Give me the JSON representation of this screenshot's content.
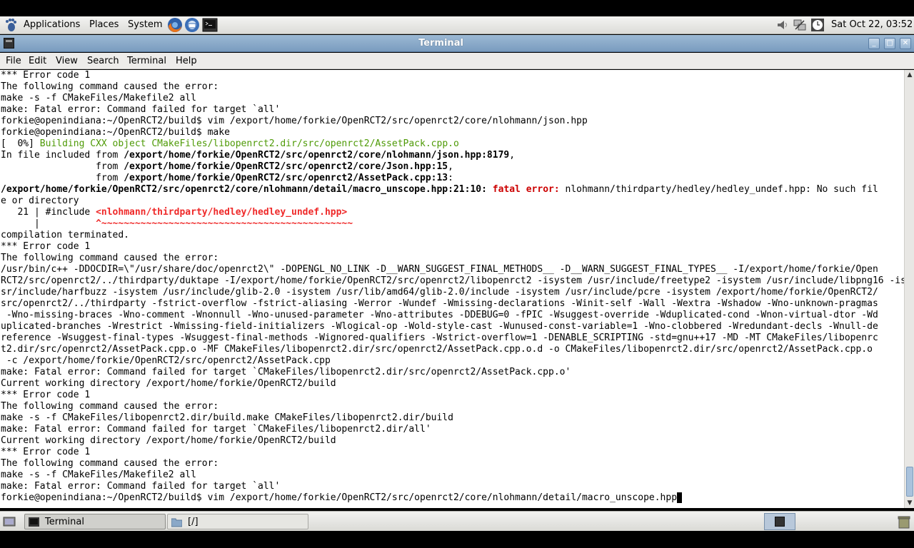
{
  "top_panel": {
    "menus": [
      "Applications",
      "Places",
      "System"
    ],
    "clock": "Sat Oct 22, 03:52"
  },
  "window": {
    "title": "Terminal",
    "buttons": [
      "minimize",
      "maximize",
      "close"
    ]
  },
  "menubar": [
    "File",
    "Edit",
    "View",
    "Search",
    "Terminal",
    "Help"
  ],
  "terminal": {
    "lines": [
      [
        {
          "t": "*** Error code 1"
        }
      ],
      [
        {
          "t": "The following command caused the error:"
        }
      ],
      [
        {
          "t": "make -s -f CMakeFiles/Makefile2 all"
        }
      ],
      [
        {
          "t": "make: Fatal error: Command failed for target `all'"
        }
      ],
      [
        {
          "t": "forkie@openindiana:~/OpenRCT2/build$ vim /export/home/forkie/OpenRCT2/src/openrct2/core/nlohmann/json.hpp"
        }
      ],
      [
        {
          "t": "forkie@openindiana:~/OpenRCT2/build$ make"
        }
      ],
      [
        {
          "t": "[  0%] "
        },
        {
          "t": "Building CXX object CMakeFiles/libopenrct2.dir/src/openrct2/AssetPack.cpp.o",
          "s": "green"
        }
      ],
      [
        {
          "t": "In file included from "
        },
        {
          "t": "/export/home/forkie/OpenRCT2/src/openrct2/core/nlohmann/json.hpp:8179",
          "s": "b"
        },
        {
          "t": ","
        }
      ],
      [
        {
          "t": "                 from "
        },
        {
          "t": "/export/home/forkie/OpenRCT2/src/openrct2/core/Json.hpp:15",
          "s": "b"
        },
        {
          "t": ","
        }
      ],
      [
        {
          "t": "                 from "
        },
        {
          "t": "/export/home/forkie/OpenRCT2/src/openrct2/AssetPack.cpp:13",
          "s": "b"
        },
        {
          "t": ":"
        }
      ],
      [
        {
          "t": "/export/home/forkie/OpenRCT2/src/openrct2/core/nlohmann/detail/macro_unscope.hpp:21:10:",
          "s": "b"
        },
        {
          "t": " "
        },
        {
          "t": "fatal error:",
          "s": "red"
        },
        {
          "t": " nlohmann/thirdparty/hedley/hedley_undef.hpp: No such fil"
        }
      ],
      [
        {
          "t": "e or directory"
        }
      ],
      [
        {
          "t": "   21 | #include "
        },
        {
          "t": "<nlohmann/thirdparty/hedley/hedley_undef.hpp>",
          "s": "redb"
        }
      ],
      [
        {
          "t": "      |          "
        },
        {
          "t": "^~~~~~~~~~~~~~~~~~~~~~~~~~~~~~~~~~~~~~~~~~~~~~",
          "s": "redb"
        }
      ],
      [
        {
          "t": "compilation terminated."
        }
      ],
      [
        {
          "t": "*** Error code 1"
        }
      ],
      [
        {
          "t": "The following command caused the error:"
        }
      ],
      [
        {
          "t": "/usr/bin/c++ -DDOCDIR=\\\"/usr/share/doc/openrct2\\\" -DOPENGL_NO_LINK -D__WARN_SUGGEST_FINAL_METHODS__ -D__WARN_SUGGEST_FINAL_TYPES__ -I/export/home/forkie/Open"
        }
      ],
      [
        {
          "t": "RCT2/src/openrct2/../thirdparty/duktape -I/export/home/forkie/OpenRCT2/src/openrct2/libopenrct2 -isystem /usr/include/freetype2 -isystem /usr/include/libpng16 -isystem /u"
        }
      ],
      [
        {
          "t": "sr/include/harfbuzz -isystem /usr/include/glib-2.0 -isystem /usr/lib/amd64/glib-2.0/include -isystem /usr/include/pcre -isystem /export/home/forkie/OpenRCT2/"
        }
      ],
      [
        {
          "t": "src/openrct2/../thirdparty -fstrict-overflow -fstrict-aliasing -Werror -Wundef -Wmissing-declarations -Winit-self -Wall -Wextra -Wshadow -Wno-unknown-pragmas"
        }
      ],
      [
        {
          "t": " -Wno-missing-braces -Wno-comment -Wnonnull -Wno-unused-parameter -Wno-attributes -DDEBUG=0 -fPIC -Wsuggest-override -Wduplicated-cond -Wnon-virtual-dtor -Wd"
        }
      ],
      [
        {
          "t": "uplicated-branches -Wrestrict -Wmissing-field-initializers -Wlogical-op -Wold-style-cast -Wunused-const-variable=1 -Wno-clobbered -Wredundant-decls -Wnull-de"
        }
      ],
      [
        {
          "t": "reference -Wsuggest-final-types -Wsuggest-final-methods -Wignored-qualifiers -Wstrict-overflow=1 -DENABLE_SCRIPTING -std=gnu++17 -MD -MT CMakeFiles/libopenrc"
        }
      ],
      [
        {
          "t": "t2.dir/src/openrct2/AssetPack.cpp.o -MF CMakeFiles/libopenrct2.dir/src/openrct2/AssetPack.cpp.o.d -o CMakeFiles/libopenrct2.dir/src/openrct2/AssetPack.cpp.o"
        }
      ],
      [
        {
          "t": " -c /export/home/forkie/OpenRCT2/src/openrct2/AssetPack.cpp"
        }
      ],
      [
        {
          "t": "make: Fatal error: Command failed for target `CMakeFiles/libopenrct2.dir/src/openrct2/AssetPack.cpp.o'"
        }
      ],
      [
        {
          "t": "Current working directory /export/home/forkie/OpenRCT2/build"
        }
      ],
      [
        {
          "t": "*** Error code 1"
        }
      ],
      [
        {
          "t": "The following command caused the error:"
        }
      ],
      [
        {
          "t": "make -s -f CMakeFiles/libopenrct2.dir/build.make CMakeFiles/libopenrct2.dir/build"
        }
      ],
      [
        {
          "t": "make: Fatal error: Command failed for target `CMakeFiles/libopenrct2.dir/all'"
        }
      ],
      [
        {
          "t": "Current working directory /export/home/forkie/OpenRCT2/build"
        }
      ],
      [
        {
          "t": "*** Error code 1"
        }
      ],
      [
        {
          "t": "The following command caused the error:"
        }
      ],
      [
        {
          "t": "make -s -f CMakeFiles/Makefile2 all"
        }
      ],
      [
        {
          "t": "make: Fatal error: Command failed for target `all'"
        }
      ],
      [
        {
          "t": "forkie@openindiana:~/OpenRCT2/build$ vim /export/home/forkie/OpenRCT2/src/openrct2/core/nlohmann/detail/macro_unscope.hpp"
        }
      ]
    ]
  },
  "taskbar": {
    "tasks": [
      {
        "label": "Terminal",
        "icon": "terminal-icon",
        "active": true
      },
      {
        "label": "[/]",
        "icon": "folder-icon",
        "active": false
      }
    ]
  },
  "colors": {
    "prompt_green": "#4e9a06",
    "error_red": "#cc0000",
    "titlebar": "#7a9cbf"
  }
}
